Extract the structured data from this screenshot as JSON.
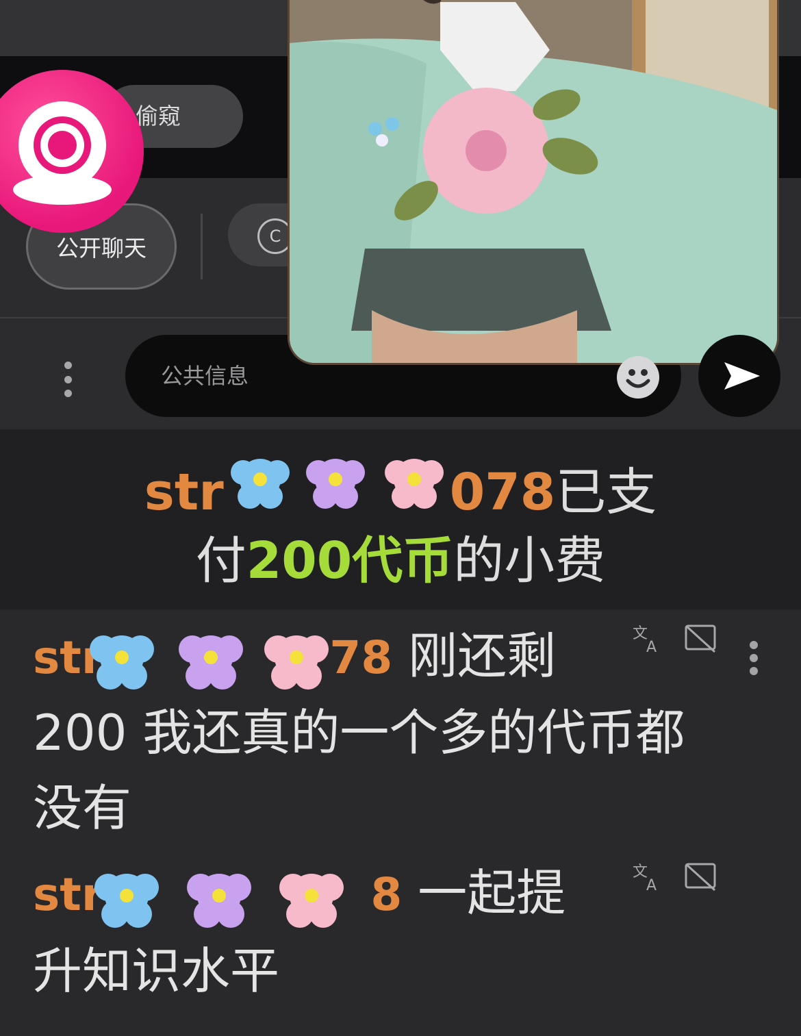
{
  "header": {
    "spy_label": "偷窥",
    "logo_icon": "webcam-icon"
  },
  "tabs": {
    "public_chat": "公开聊天",
    "second_tab_icon": "C"
  },
  "composer": {
    "placeholder": "公共信息",
    "emoji_icon": "smiley-icon",
    "send_icon": "send-icon"
  },
  "tip_notice": {
    "user_prefix": "str",
    "user_suffix": "078",
    "text_after_name": "已支",
    "text_pay": "付",
    "amount": "200代币",
    "text_end": "的小费"
  },
  "messages": [
    {
      "user_prefix": "str",
      "user_suffix": "78",
      "line1": "刚还剩",
      "line2": "200 我还真的一个多的代币都",
      "line3": "没有"
    },
    {
      "user_prefix": "str",
      "user_suffix": "8",
      "line1": "一起提",
      "line2": "升知识水平"
    }
  ],
  "colors": {
    "username": "#e38840",
    "amount": "#a6dc39",
    "brand": "#e8177a"
  }
}
